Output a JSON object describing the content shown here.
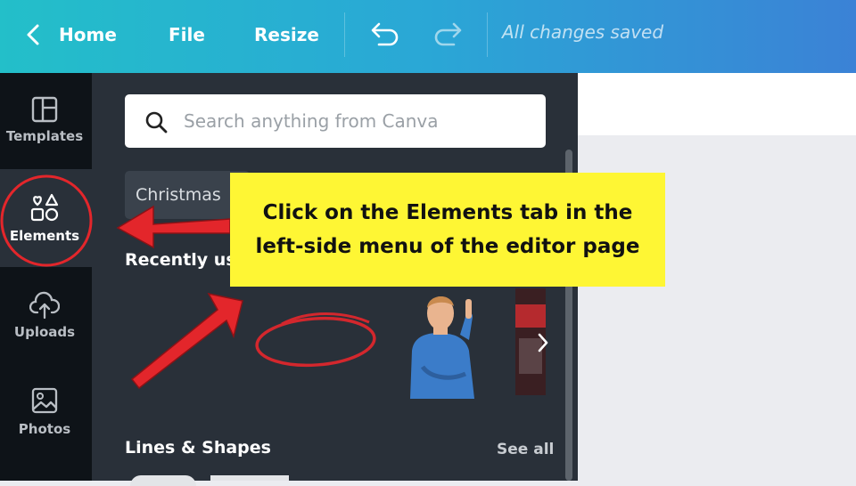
{
  "topbar": {
    "home_label": "Home",
    "file_label": "File",
    "resize_label": "Resize",
    "status_text": "All changes saved",
    "icons": [
      "chevron-left-icon",
      "undo-icon",
      "redo-icon"
    ]
  },
  "sidebar": {
    "items": [
      {
        "label": "Templates",
        "icon": "templates-icon"
      },
      {
        "label": "Elements",
        "icon": "elements-icon",
        "active": true
      },
      {
        "label": "Uploads",
        "icon": "upload-cloud-icon"
      },
      {
        "label": "Photos",
        "icon": "photos-icon"
      }
    ]
  },
  "panel": {
    "search_placeholder": "Search anything from Canva",
    "chip_label": "Christmas",
    "recent_title": "Recently us",
    "lines_shapes_title": "Lines & Shapes",
    "see_all_label": "See all"
  },
  "annotation": {
    "callout_line1": "Click on the Elements tab in the",
    "callout_line2": "left-side menu of the editor page"
  },
  "colors": {
    "topbar_start": "#23bfc9",
    "topbar_end": "#3b82d6",
    "rail_bg": "#0e1318",
    "panel_bg": "#293039",
    "callout_bg": "#fef634",
    "annotation_red": "#e3262b"
  }
}
